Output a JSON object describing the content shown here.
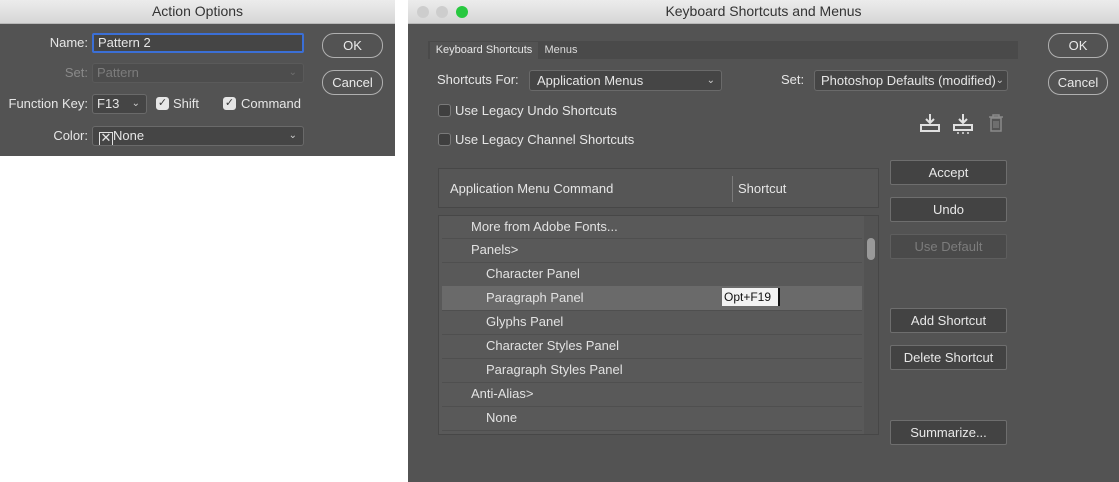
{
  "action_options": {
    "title": "Action Options",
    "name_label": "Name:",
    "name_value": "Pattern 2",
    "set_label": "Set:",
    "set_value": "Pattern",
    "function_key_label": "Function Key:",
    "function_key_value": "F13",
    "shift_label": "Shift",
    "shift_checked": true,
    "command_label": "Command",
    "command_checked": true,
    "color_label": "Color:",
    "color_value": "None",
    "ok_label": "OK",
    "cancel_label": "Cancel"
  },
  "keyboard_shortcuts": {
    "title": "Keyboard Shortcuts and Menus",
    "tabs": [
      {
        "label": "Keyboard Shortcuts",
        "active": true
      },
      {
        "label": "Menus",
        "active": false
      }
    ],
    "shortcuts_for_label": "Shortcuts For:",
    "shortcuts_for_value": "Application Menus",
    "set_label": "Set:",
    "set_value": "Photoshop Defaults (modified)",
    "legacy_undo_label": "Use Legacy Undo Shortcuts",
    "legacy_channel_label": "Use Legacy Channel Shortcuts",
    "icons": [
      "save-set-icon",
      "save-set-as-icon",
      "trash-icon"
    ],
    "table_headers": {
      "command": "Application Menu Command",
      "shortcut": "Shortcut"
    },
    "rows": [
      {
        "label": "More from Adobe Fonts...",
        "indent": 1,
        "shortcut": ""
      },
      {
        "label": "Panels>",
        "indent": 1,
        "shortcut": ""
      },
      {
        "label": "Character Panel",
        "indent": 2,
        "shortcut": ""
      },
      {
        "label": "Paragraph Panel",
        "indent": 2,
        "shortcut": "Opt+F19",
        "selected": true
      },
      {
        "label": "Glyphs Panel",
        "indent": 2,
        "shortcut": ""
      },
      {
        "label": "Character Styles Panel",
        "indent": 2,
        "shortcut": ""
      },
      {
        "label": "Paragraph Styles Panel",
        "indent": 2,
        "shortcut": ""
      },
      {
        "label": "Anti-Alias>",
        "indent": 1,
        "shortcut": ""
      },
      {
        "label": "None",
        "indent": 2,
        "shortcut": ""
      }
    ],
    "accept_label": "Accept",
    "undo_label": "Undo",
    "use_default_label": "Use Default",
    "add_shortcut_label": "Add Shortcut",
    "delete_shortcut_label": "Delete Shortcut",
    "summarize_label": "Summarize...",
    "ok_label": "OK",
    "cancel_label": "Cancel"
  },
  "colors": {
    "panel_bg": "#535353",
    "selection_row": "#6a6a6a",
    "name_field_focus": "#3b6fd6",
    "traffic_green": "#28c840"
  }
}
